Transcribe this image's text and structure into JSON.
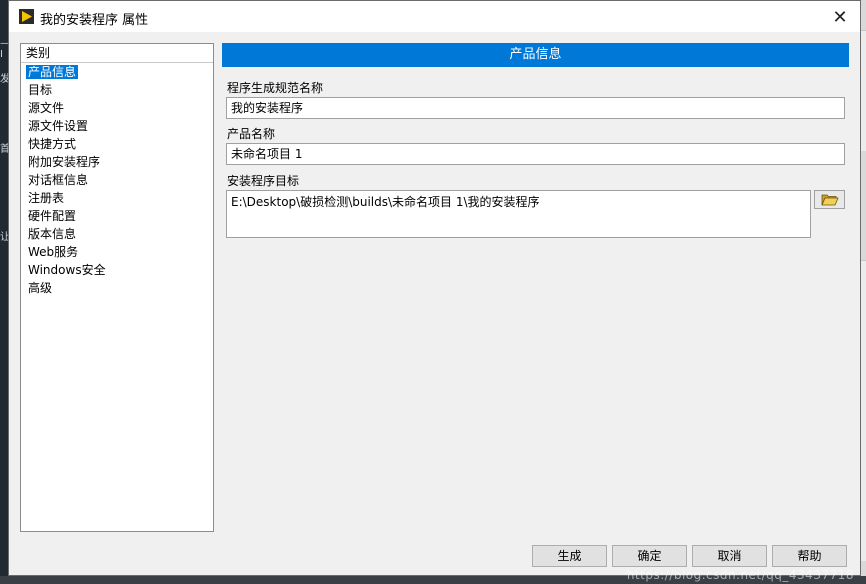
{
  "window": {
    "title": "我的安装程序 属性",
    "close_glyph": "✕"
  },
  "categories": {
    "header": "类别",
    "items": [
      "产品信息",
      "目标",
      "源文件",
      "源文件设置",
      "快捷方式",
      "附加安装程序",
      "对话框信息",
      "注册表",
      "硬件配置",
      "版本信息",
      "Web服务",
      "Windows安全",
      "高级"
    ],
    "selected_index": 0
  },
  "main": {
    "section_title": "产品信息",
    "build_spec_label": "程序生成规范名称",
    "build_spec_value": "我的安装程序",
    "product_name_label": "产品名称",
    "product_name_value": "未命名项目 1",
    "installer_dest_label": "安装程序目标",
    "installer_dest_value": "E:\\Desktop\\破损检测\\builds\\未命名项目 1\\我的安装程序"
  },
  "buttons": {
    "build": "生成",
    "ok": "确定",
    "cancel": "取消",
    "help": "帮助"
  },
  "icons": {
    "app": "labview-arrow-icon",
    "browse": "folder-open-icon",
    "close": "close-icon"
  },
  "colors": {
    "accent": "#0078d7",
    "app_icon": "#f5c400"
  },
  "background": {
    "watermark": "https://blog.csdn.net/qq_43437718"
  }
}
